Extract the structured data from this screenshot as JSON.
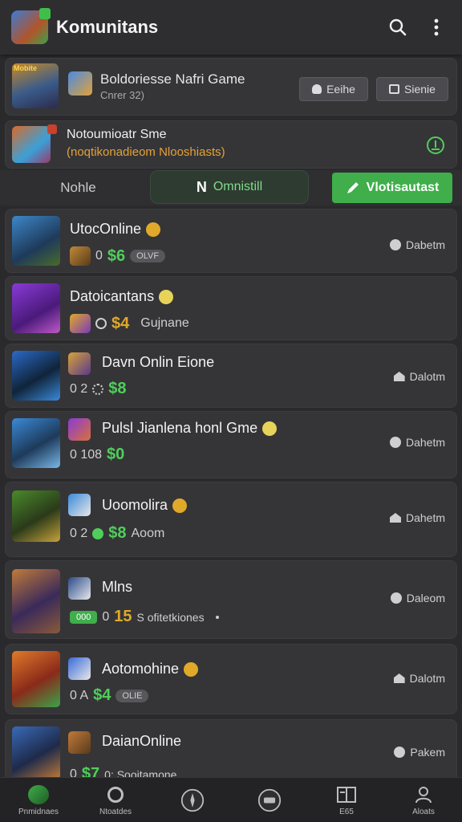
{
  "app": {
    "title": "Komunitans"
  },
  "featured": {
    "banner_text": "Mobite",
    "title": "Boldoriesse Nafri Game",
    "subtitle": "Cnrer 32)",
    "button1": "Eeihe",
    "button2": "Sienie"
  },
  "notification": {
    "title": "Notoumioatr Sme",
    "subtitle": "(noqtikonadieom Nlooshiasts)"
  },
  "tabs": {
    "plain": "Nohle",
    "active": "Omnistill",
    "cta": "Vlotisautast"
  },
  "rows": [
    {
      "title": "UtocOnline",
      "count": "0",
      "price": "$6",
      "price_color": "green",
      "tag": "OLVF",
      "status": "Dabetm",
      "status_icon": "dot"
    },
    {
      "title": "Datoicantans",
      "count": "",
      "price": "$4",
      "price_color": "gold",
      "tag_text": "Gujnane",
      "status": "",
      "status_icon": ""
    },
    {
      "title": "Davn Onlin Eione",
      "count": "0 2",
      "price": "$8",
      "price_color": "green",
      "status": "Dalotm",
      "status_icon": "house"
    },
    {
      "title": "Pulsl Jianlena honl Gme",
      "count": "0 108",
      "price": "$0",
      "price_color": "green",
      "status": "Dahetm",
      "status_icon": "dot"
    },
    {
      "title": "Uoomolira",
      "count": "0 2",
      "price": "$8",
      "price_color": "green",
      "tag_text": "Aoom",
      "status": "Dahetm",
      "status_icon": "house"
    },
    {
      "title": "Mlns",
      "badge": "000",
      "count": "0",
      "price": "15",
      "price_color": "gold",
      "tag_text": "S ofitetkiones",
      "status": "Daleom",
      "status_icon": "dot"
    },
    {
      "title": "Aotomohine",
      "count": "0 A",
      "price": "$4",
      "price_color": "green",
      "tag": "OLIE",
      "status": "Dalotm",
      "status_icon": "house"
    },
    {
      "title": "DaianOnline",
      "count": "0",
      "price": "$7",
      "price_color": "green",
      "tag_text": "0: Sooitamone",
      "status": "Pakem",
      "status_icon": "dot"
    }
  ],
  "bottom_nav": [
    {
      "label": "Pnmidnaes",
      "icon": "home-icon"
    },
    {
      "label": "Ntoatdes",
      "icon": "news-icon"
    },
    {
      "label": "",
      "icon": "compass-icon"
    },
    {
      "label": "",
      "icon": "chat-icon"
    },
    {
      "label": "E65",
      "icon": "list-icon"
    },
    {
      "label": "Aloats",
      "icon": "profile-icon"
    }
  ],
  "colors": {
    "accent": "#3fae4b",
    "background": "#2a2a2d",
    "card": "#353538",
    "gold": "#e0a92a"
  }
}
